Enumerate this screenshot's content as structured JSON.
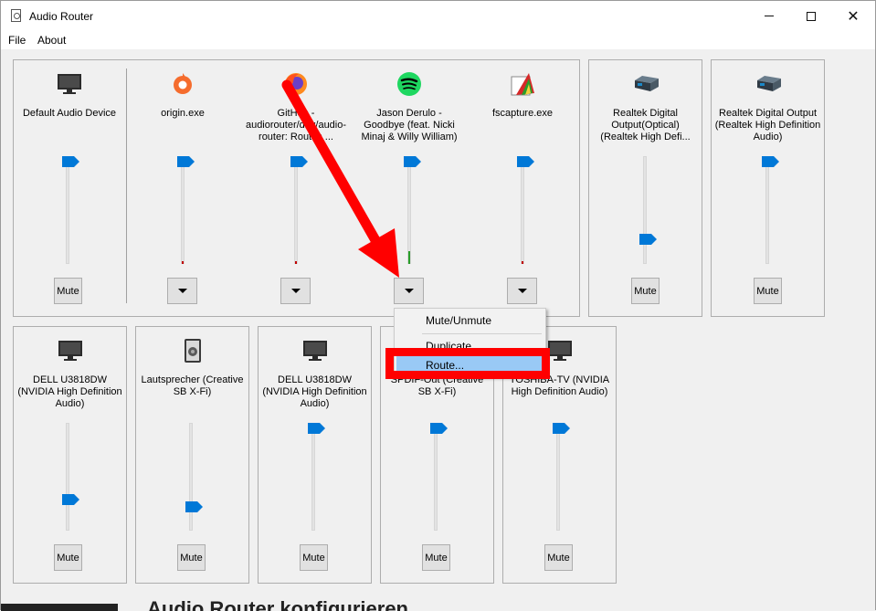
{
  "window": {
    "title": "Audio Router"
  },
  "menu": [
    "File",
    "About"
  ],
  "mute_label": "Mute",
  "colors": {
    "slider_thumb": "#0078d7",
    "meter_red": "#c00000",
    "meter_green": "#2a9d2a",
    "highlight": "#99c9f5",
    "annotation_red": "#ff0000"
  },
  "output_devices": [
    {
      "label": "Default Audio Device",
      "icon": "monitor-icon",
      "volume": 0.98
    },
    {
      "label": "Realtek Digital Output(Optical) (Realtek High Defi...",
      "icon": "audio-device-icon",
      "volume": 0.18
    },
    {
      "label": "Realtek Digital Output (Realtek High Definition Audio)",
      "icon": "audio-device-icon",
      "volume": 0.98
    }
  ],
  "apps": [
    {
      "label": "origin.exe",
      "icon": "origin-icon",
      "volume": 0.98
    },
    {
      "label": "GitHub - audiorouter/dev/audio-router: Routes ...",
      "icon": "firefox-icon",
      "volume": 0.98
    },
    {
      "label": "Jason Derulo - Goodbye (feat. Nicki Minaj & Willy William)",
      "icon": "spotify-icon",
      "volume": 0.98
    },
    {
      "label": "fscapture.exe",
      "icon": "fscapture-icon",
      "volume": 0.98
    }
  ],
  "devices_row2": [
    {
      "label": "DELL U3818DW (NVIDIA High Definition Audio)",
      "icon": "monitor-icon",
      "volume": 0.25
    },
    {
      "label": "Lautsprecher (Creative SB X-Fi)",
      "icon": "speaker-icon",
      "volume": 0.17
    },
    {
      "label": "DELL U3818DW (NVIDIA High Definition Audio)",
      "icon": "monitor-icon",
      "volume": 0.98
    },
    {
      "label": "SPDIF-Out (Creative SB X-Fi)",
      "icon": "audio-device-icon",
      "volume": 0.98
    },
    {
      "label": "TOSHIBA-TV (NVIDIA High Definition Audio)",
      "icon": "monitor-icon",
      "volume": 0.98
    }
  ],
  "context_menu": {
    "items": [
      "Mute/Unmute",
      "Duplicate",
      "Route..."
    ],
    "highlighted": "Route..."
  },
  "background_text": "Audio Router konfigurieren"
}
